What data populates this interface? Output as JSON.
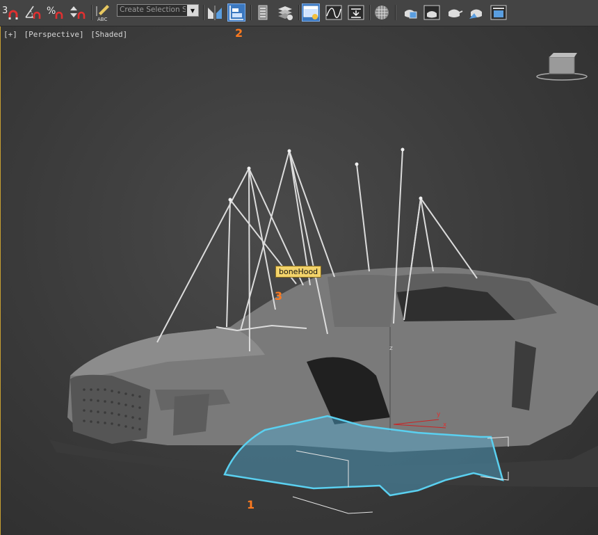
{
  "toolbar": {
    "snap_3d_label": "3",
    "percent_snap_label": "%",
    "selection_set_placeholder": "Create Selection Se",
    "items": [
      {
        "name": "snaps-toggle-icon"
      },
      {
        "name": "angle-snap-icon"
      },
      {
        "name": "percent-snap-icon"
      },
      {
        "name": "spinner-snap-icon"
      },
      {
        "name": "edit-named-selection-icon"
      },
      {
        "name": "mirror-icon"
      },
      {
        "name": "align-icon"
      },
      {
        "name": "scene-explorer-icon"
      },
      {
        "name": "layer-manager-icon"
      },
      {
        "name": "toggle-ribbon-icon"
      },
      {
        "name": "curve-editor-icon"
      },
      {
        "name": "schematic-view-icon"
      },
      {
        "name": "material-editor-icon"
      },
      {
        "name": "render-setup-icon"
      },
      {
        "name": "rendered-frame-window-icon"
      },
      {
        "name": "render-production-icon"
      },
      {
        "name": "render-iterative-icon"
      },
      {
        "name": "render-activeshade-icon"
      },
      {
        "name": "render-in-cloud-icon"
      }
    ]
  },
  "viewport": {
    "label_plus": "[+]",
    "label_view": "[Perspective]",
    "label_shading": "[Shaded]",
    "tooltip": "boneHood",
    "axis_y": "y",
    "axis_x": "x",
    "axis_z": "z"
  },
  "callouts": [
    "1",
    "2",
    "3"
  ],
  "colors": {
    "active_button": "#3b78c0",
    "callout": "#ff7a1f",
    "tooltip_bg": "#f3d36a",
    "selection_highlight": "#5ad0f0"
  }
}
